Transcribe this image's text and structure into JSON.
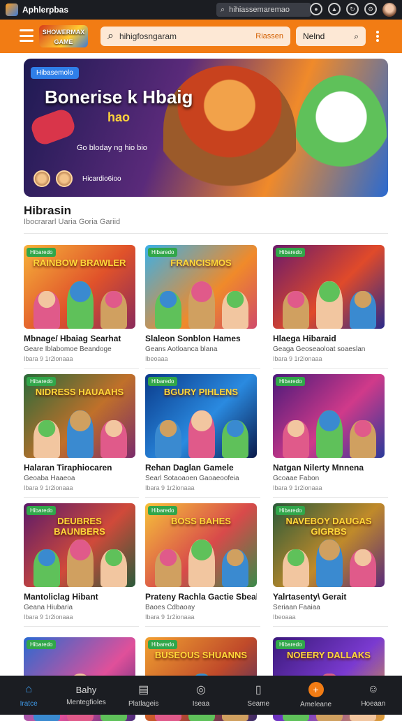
{
  "status": {
    "app_name": "Aphlerpbas",
    "url": "hihiassemaremao"
  },
  "header": {
    "brand_text": "SHOWERMAX GAME",
    "search_value": "hihigfosngaram",
    "search_tag": "Riassen",
    "filter_label": "Nelnd"
  },
  "hero": {
    "badge": "Hibasemolo",
    "title": "Bonerise k Hbaig",
    "subtitle": "hao",
    "meta": "Go bloday ng hio bio",
    "avatar_label": "Hicardio6ioo"
  },
  "section": {
    "title": "Hibrasin",
    "subtitle": "Ibocrararl Uaria Goria Gariid"
  },
  "cards": [
    {
      "badge": "Hibaredo",
      "art": "RAINBOW BRAWLER",
      "title": "Mbnage/ Hbaiag Searhat",
      "subtitle": "Geare Iblabomoe Beandoge",
      "meta": "Ibara 9 1r2ionaaa"
    },
    {
      "badge": "Hibaredo",
      "art": "FRANCISMOS",
      "title": "Slaleon Sonblon Hames",
      "subtitle": "Geans Aotloanca blana",
      "meta": "Ibeoaaa"
    },
    {
      "badge": "Hibaredo",
      "art": "",
      "title": "Hlaega Hibaraid",
      "subtitle": "Geaga Geoseaoloat soaeslan",
      "meta": "Ibara 9 1r2ionaaa"
    },
    {
      "badge": "Hibaredo",
      "art": "NIDRESS HAUAAHS",
      "title": "Halaran Tiraphiocaren",
      "subtitle": "Geoaba Haaeoa",
      "meta": "Ibara 9 1r2ionaaa"
    },
    {
      "badge": "Hibaredo",
      "art": "BGURY PIHLENS",
      "title": "Rehan Daglan Gamele",
      "subtitle": "Searl Sotaoaoen Gaoaeoofeia",
      "meta": "Ibara 9 1r2ionaaa"
    },
    {
      "badge": "Hibaredo",
      "art": "",
      "title": "Natgan Nilerty Mnnena",
      "subtitle": "Gcoaae Fabon",
      "meta": "Ibara 9 1r2ionaaa"
    },
    {
      "badge": "Hibaredo",
      "art": "DEUBRES BAUNBERS",
      "title": "Mantoliclag Hibant",
      "subtitle": "Geana Hiubaria",
      "meta": "Ibara 9 1r2ionaaa"
    },
    {
      "badge": "Hibaredo",
      "art": "BOSS BAHES",
      "title": "Prateny Rachla Gactie Sbeals",
      "subtitle": "Baoes Cdbaoay",
      "meta": "Ibara 9 1r2ionaaa"
    },
    {
      "badge": "Hibaredo",
      "art": "NAVEBOY DAUGAS GIGRBS",
      "title": "Yalrtasenty\\ Gerait",
      "subtitle": "Seriaan Faaiaa",
      "meta": "Ibeoaaa"
    },
    {
      "badge": "Hibaredo",
      "art": "",
      "title": "",
      "subtitle": "",
      "meta": ""
    },
    {
      "badge": "Hibaredo",
      "art": "BUSEOUS SHUANNS",
      "title": "",
      "subtitle": "",
      "meta": ""
    },
    {
      "badge": "Hibaredo",
      "art": "NOEERY DALLAKS",
      "title": "",
      "subtitle": "",
      "meta": ""
    }
  ],
  "nav": [
    {
      "label": "Iratce",
      "icon": "home-icon"
    },
    {
      "label": "Mentegfioles",
      "icon": "grid-icon",
      "top": "Bahy"
    },
    {
      "label": "Platlageis",
      "icon": "list-icon"
    },
    {
      "label": "Iseaa",
      "icon": "compass-icon"
    },
    {
      "label": "Seame",
      "icon": "document-icon"
    },
    {
      "label": "Ameleane",
      "icon": "plus-icon"
    },
    {
      "label": "Hoeaan",
      "icon": "profile-icon"
    }
  ],
  "colors": {
    "accent": "#f27c14",
    "nav_active": "#3f9ae8",
    "dark": "#1b1d22"
  }
}
